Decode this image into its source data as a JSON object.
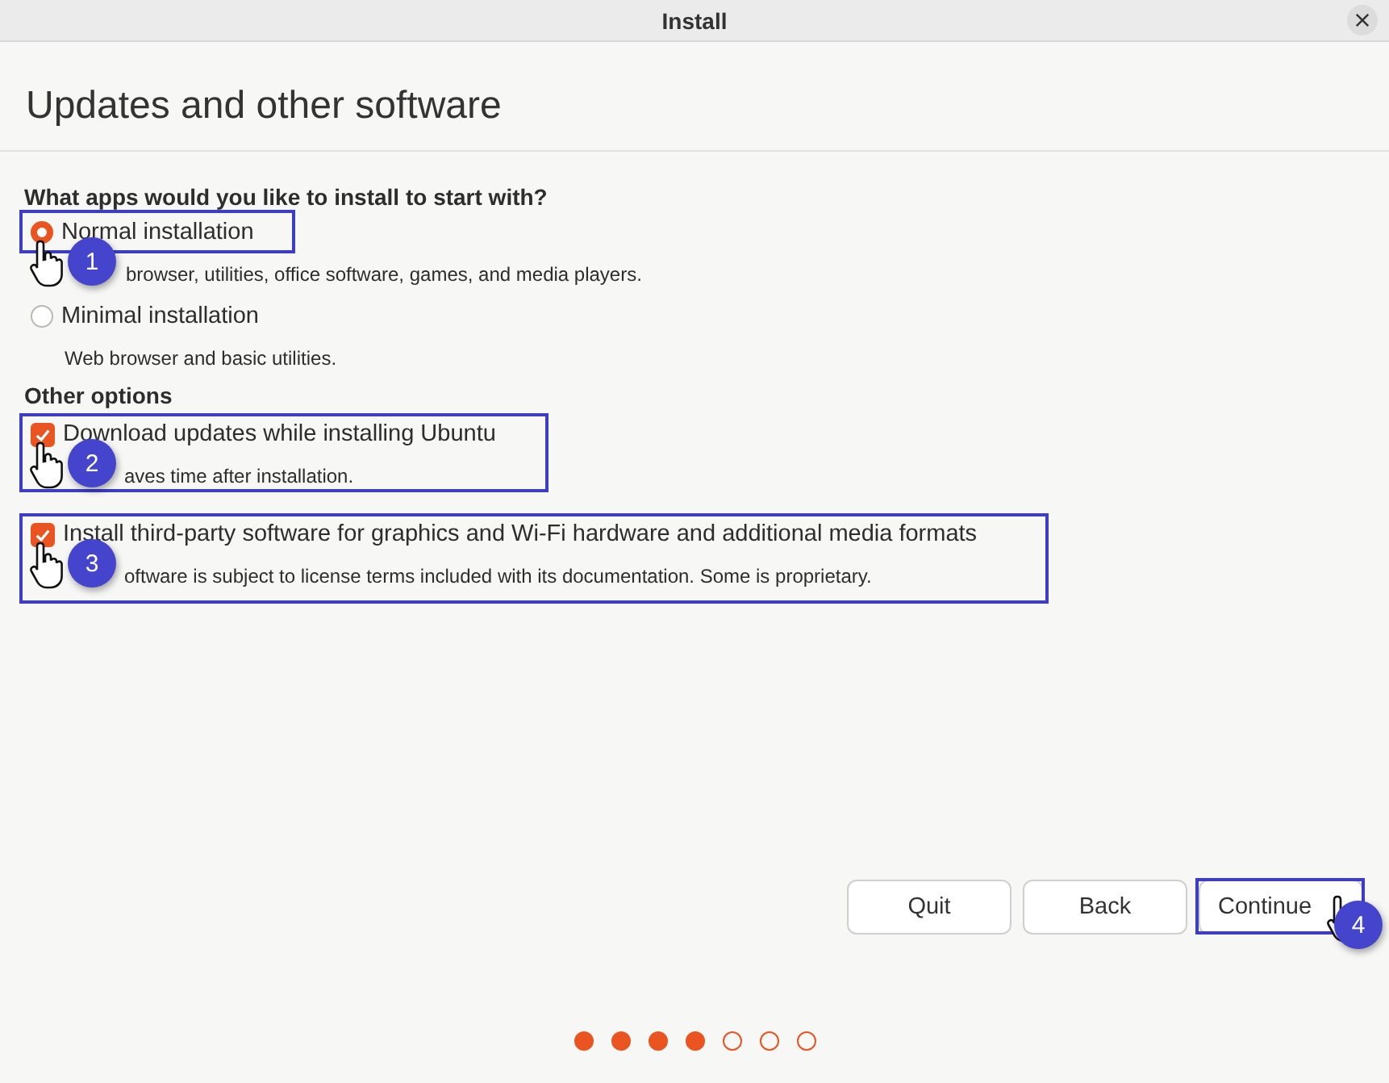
{
  "window": {
    "title": "Install"
  },
  "heading": "Updates and other software",
  "install_section": {
    "title": "What apps would you like to install to start with?",
    "options": [
      {
        "label": "Normal installation",
        "description": "browser, utilities, office software, games, and media players.",
        "selected": true,
        "annotation": "1"
      },
      {
        "label": "Minimal installation",
        "description": "Web browser and basic utilities.",
        "selected": false
      }
    ]
  },
  "other_section": {
    "title": "Other options",
    "options": [
      {
        "label": "Download updates while installing Ubuntu",
        "description": "aves time after installation.",
        "checked": true,
        "annotation": "2"
      },
      {
        "label": "Install third-party software for graphics and Wi-Fi hardware and additional media formats",
        "description": "oftware is subject to license terms included with its documentation. Some is proprietary.",
        "checked": true,
        "annotation": "3"
      }
    ]
  },
  "buttons": [
    {
      "label": "Quit"
    },
    {
      "label": "Back"
    },
    {
      "label": "Continue",
      "annotation": "4"
    }
  ],
  "progress_dots": [
    {
      "filled": true
    },
    {
      "filled": true
    },
    {
      "filled": true
    },
    {
      "filled": true
    },
    {
      "filled": false
    },
    {
      "filled": false
    },
    {
      "filled": false
    }
  ]
}
